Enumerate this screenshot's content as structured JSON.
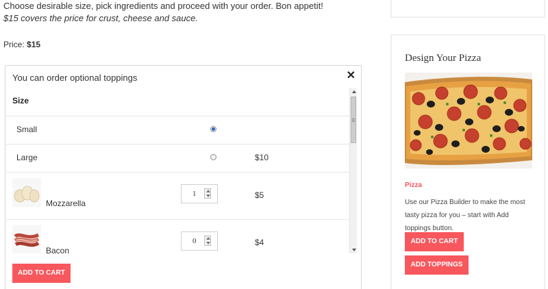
{
  "intro": {
    "line1": "Choose desirable size, pick ingredients and proceed with your order. Bon appetit!",
    "line2": "$15 covers the price for crust, cheese and sauce."
  },
  "price": {
    "label": "Price:",
    "value": "$15"
  },
  "toppings_panel": {
    "title": "You can order optional toppings",
    "close_icon": "close-icon",
    "size_heading": "Size",
    "sizes": [
      {
        "label": "Small",
        "price": "",
        "checked": true
      },
      {
        "label": "Large",
        "price": "$10",
        "checked": false
      }
    ],
    "toppings": [
      {
        "label": "Mozzarella",
        "quantity": "1",
        "price": "$5"
      },
      {
        "label": "Bacon",
        "quantity": "0",
        "price": "$4"
      }
    ],
    "add_to_cart_label": "ADD TO CART"
  },
  "sidebar": {
    "title": "Design Your Pizza",
    "product_name": "Pizza",
    "description": "Use our Pizza Builder to make the most tasty pizza for you – start with Add toppings button.",
    "add_to_cart_label": "ADD TO CART",
    "add_toppings_label": "ADD TOPPINGS"
  },
  "colors": {
    "accent": "#f7575d",
    "radio_checked": "#2a64c4"
  }
}
